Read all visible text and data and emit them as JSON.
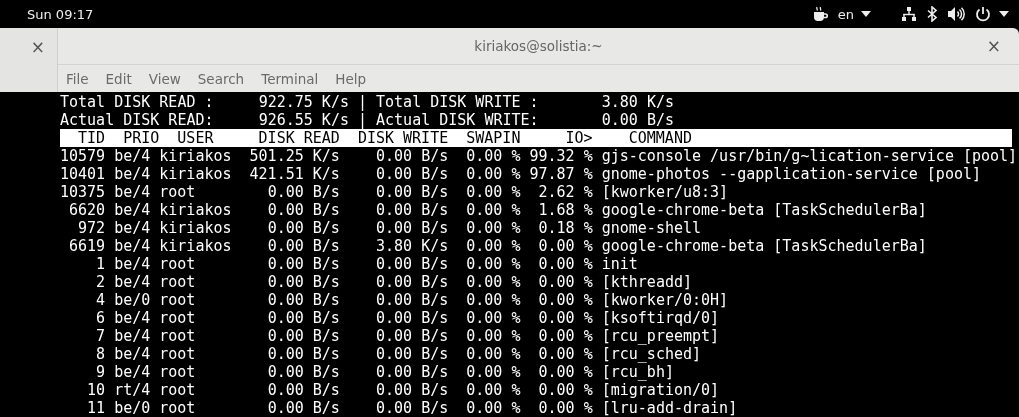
{
  "top_bar": {
    "clock": "Sun 09:17",
    "language": "en"
  },
  "side_tab": {
    "close": "×"
  },
  "window": {
    "title": "kiriakos@solistia:~",
    "close": "×"
  },
  "menu": [
    "File",
    "Edit",
    "View",
    "Search",
    "Terminal",
    "Help"
  ],
  "terminal": {
    "summary": [
      {
        "read_label": "Total DISK READ :",
        "read_value": "922.75 K/s",
        "separator": "|",
        "write_label": "Total DISK WRITE :",
        "write_value": "3.80 K/s"
      },
      {
        "read_label": "Actual DISK READ:",
        "read_value": "926.55 K/s",
        "separator": "|",
        "write_label": "Actual DISK WRITE:",
        "write_value": "0.00 B/s"
      }
    ],
    "columns": [
      "TID",
      "PRIO",
      "USER",
      "DISK READ",
      "DISK WRITE",
      "SWAPIN",
      "IO>",
      "COMMAND"
    ],
    "rows": [
      {
        "tid": "10579",
        "prio": "be/4",
        "user": "kiriakos",
        "disk_read": "501.25 K/s",
        "disk_write": "0.00 B/s",
        "swapin": "0.00 %",
        "io": "99.32 %",
        "command": "gjs-console /usr/bin/g~lication-service [pool]"
      },
      {
        "tid": "10401",
        "prio": "be/4",
        "user": "kiriakos",
        "disk_read": "421.51 K/s",
        "disk_write": "0.00 B/s",
        "swapin": "0.00 %",
        "io": "97.87 %",
        "command": "gnome-photos --gapplication-service [pool]"
      },
      {
        "tid": "10375",
        "prio": "be/4",
        "user": "root",
        "disk_read": "0.00 B/s",
        "disk_write": "0.00 B/s",
        "swapin": "0.00 %",
        "io": "2.62 %",
        "command": "[kworker/u8:3]"
      },
      {
        "tid": "6620",
        "prio": "be/4",
        "user": "kiriakos",
        "disk_read": "0.00 B/s",
        "disk_write": "0.00 B/s",
        "swapin": "0.00 %",
        "io": "1.68 %",
        "command": "google-chrome-beta [TaskSchedulerBa]"
      },
      {
        "tid": "972",
        "prio": "be/4",
        "user": "kiriakos",
        "disk_read": "0.00 B/s",
        "disk_write": "0.00 B/s",
        "swapin": "0.00 %",
        "io": "0.18 %",
        "command": "gnome-shell"
      },
      {
        "tid": "6619",
        "prio": "be/4",
        "user": "kiriakos",
        "disk_read": "0.00 B/s",
        "disk_write": "3.80 K/s",
        "swapin": "0.00 %",
        "io": "0.00 %",
        "command": "google-chrome-beta [TaskSchedulerBa]"
      },
      {
        "tid": "1",
        "prio": "be/4",
        "user": "root",
        "disk_read": "0.00 B/s",
        "disk_write": "0.00 B/s",
        "swapin": "0.00 %",
        "io": "0.00 %",
        "command": "init"
      },
      {
        "tid": "2",
        "prio": "be/4",
        "user": "root",
        "disk_read": "0.00 B/s",
        "disk_write": "0.00 B/s",
        "swapin": "0.00 %",
        "io": "0.00 %",
        "command": "[kthreadd]"
      },
      {
        "tid": "4",
        "prio": "be/0",
        "user": "root",
        "disk_read": "0.00 B/s",
        "disk_write": "0.00 B/s",
        "swapin": "0.00 %",
        "io": "0.00 %",
        "command": "[kworker/0:0H]"
      },
      {
        "tid": "6",
        "prio": "be/4",
        "user": "root",
        "disk_read": "0.00 B/s",
        "disk_write": "0.00 B/s",
        "swapin": "0.00 %",
        "io": "0.00 %",
        "command": "[ksoftirqd/0]"
      },
      {
        "tid": "7",
        "prio": "be/4",
        "user": "root",
        "disk_read": "0.00 B/s",
        "disk_write": "0.00 B/s",
        "swapin": "0.00 %",
        "io": "0.00 %",
        "command": "[rcu_preempt]"
      },
      {
        "tid": "8",
        "prio": "be/4",
        "user": "root",
        "disk_read": "0.00 B/s",
        "disk_write": "0.00 B/s",
        "swapin": "0.00 %",
        "io": "0.00 %",
        "command": "[rcu_sched]"
      },
      {
        "tid": "9",
        "prio": "be/4",
        "user": "root",
        "disk_read": "0.00 B/s",
        "disk_write": "0.00 B/s",
        "swapin": "0.00 %",
        "io": "0.00 %",
        "command": "[rcu_bh]"
      },
      {
        "tid": "10",
        "prio": "rt/4",
        "user": "root",
        "disk_read": "0.00 B/s",
        "disk_write": "0.00 B/s",
        "swapin": "0.00 %",
        "io": "0.00 %",
        "command": "[migration/0]"
      },
      {
        "tid": "11",
        "prio": "be/0",
        "user": "root",
        "disk_read": "0.00 B/s",
        "disk_write": "0.00 B/s",
        "swapin": "0.00 %",
        "io": "0.00 %",
        "command": "[lru-add-drain]"
      }
    ]
  }
}
